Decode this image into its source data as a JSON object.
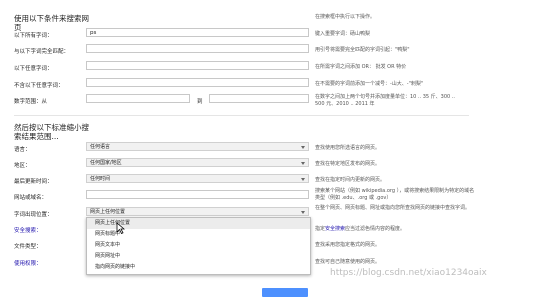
{
  "section1": {
    "heading": "使用以下条件来搜索网页",
    "heading_right": "在搜索框中执行以下操作。",
    "rows": [
      {
        "label": "以下所有字词：",
        "value": "ps",
        "help": "键入重要字词：砀山鸭梨"
      },
      {
        "label": "与以下字词完全匹配：",
        "value": "",
        "help": "用引号将需要完全匹配的字词引起：\"鸭梨\""
      },
      {
        "label": "以下任意字词：",
        "value": "",
        "help": "在所需字词之间添加 OR： 批发 OR 特价"
      },
      {
        "label": "不含以下任意字词：",
        "value": "",
        "help": "在不需要的字词前添加一个减号：-山大、-\"刺梨\""
      }
    ],
    "number_range": {
      "label": "数字范围：从",
      "to": "到",
      "help": "在数字之间加上两个句号并添加度量单位：10 .. 35 斤、300 .. 500 元、2010 .. 2011 年"
    }
  },
  "section2": {
    "heading": "然后按以下标准缩小搜索结果范围...",
    "rows": [
      {
        "label": "语言：",
        "value": "任何语言",
        "help": "查找使用您所选语言的网页。"
      },
      {
        "label": "地区：",
        "value": "任何国家/地区",
        "help": "查找在特定地区发布的网页。"
      },
      {
        "label": "最后更新时间：",
        "value": "任何时间",
        "help": "查找在指定时间内更新的网页。"
      },
      {
        "label": "网站或域名：",
        "value": "",
        "help": "搜索某个网站（例如 wikipedia.org ），或将搜索结果限制为特定的域名类型（例如 .edu、.org 或 .gov）"
      },
      {
        "label": "字词出现位置：",
        "value": "网页上任何位置",
        "help": "在整个网页、网页标题、网址或指向您所查找网页的链接中查找字词。"
      },
      {
        "label": "安全搜索：",
        "value": "",
        "help_prefix": "指定",
        "help_link": "安全搜索",
        "help_suffix": "应当过滤色情内容的程度。",
        "link": true
      },
      {
        "label": "文件类型：",
        "value": "",
        "help": "查找采用您指定格式的网页。"
      },
      {
        "label": "使用权限：",
        "value": "",
        "help": "查找可自己随意使用的网页。",
        "link": true
      }
    ],
    "dropdown_options": [
      "网页上任何位置",
      "网页标题中",
      "网页文本中",
      "网页网址中",
      "指向网页的链接中"
    ],
    "dropdown_highlighted": 0
  },
  "watermark": "https://blog.csdn.net/xiao1234oaix",
  "colors": {
    "link": "#1a0dab",
    "submit": "#4d90fe"
  }
}
